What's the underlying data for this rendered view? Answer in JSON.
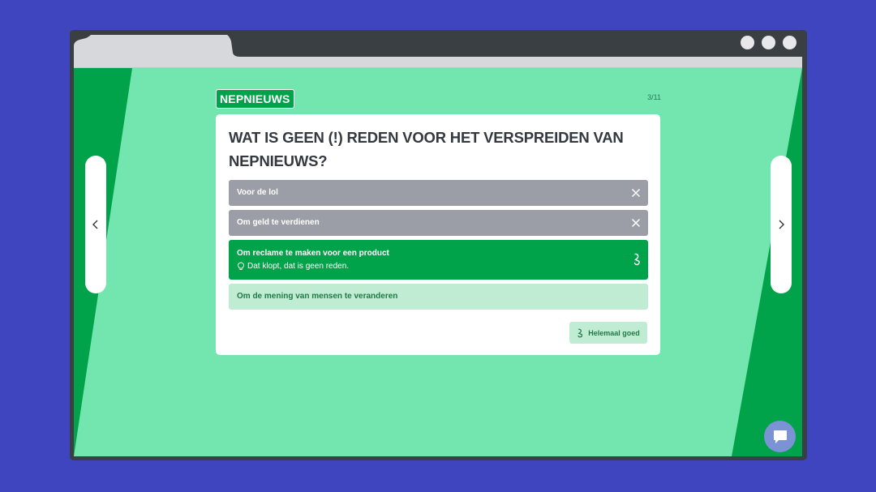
{
  "quiz": {
    "tag": "NEPNIEUWS",
    "counter": "3/11",
    "question": "WAT IS GEEN (!) REDEN VOOR HET VERSPREIDEN VAN NEPNIEUWS?",
    "answers": [
      {
        "label": "Voor de lol",
        "state": "wrong",
        "icon": "close-icon"
      },
      {
        "label": "Om geld te verdienen",
        "state": "wrong",
        "icon": "close-icon"
      },
      {
        "label": "Om reclame te maken voor een product",
        "state": "correct",
        "icon": "checkmark-icon",
        "feedback": "Dat klopt, dat is geen reden.",
        "feedback_icon": "lightbulb-icon"
      },
      {
        "label": "Om de mening van mensen te veranderen",
        "state": "neutral"
      }
    ],
    "result_label": "Helemaal goed",
    "result_icon": "checkmark-icon"
  },
  "navigation": {
    "prev_icon": "chevron-left-icon",
    "next_icon": "chevron-right-icon"
  },
  "chat_icon": "chat-bubble-icon",
  "colors": {
    "page_background": "#3f44bf",
    "viewport_green": "#72e6ae",
    "accent_green": "#00a24a",
    "wrong_gray": "#9b9ea6",
    "neutral_green": "#c1ecd4"
  }
}
